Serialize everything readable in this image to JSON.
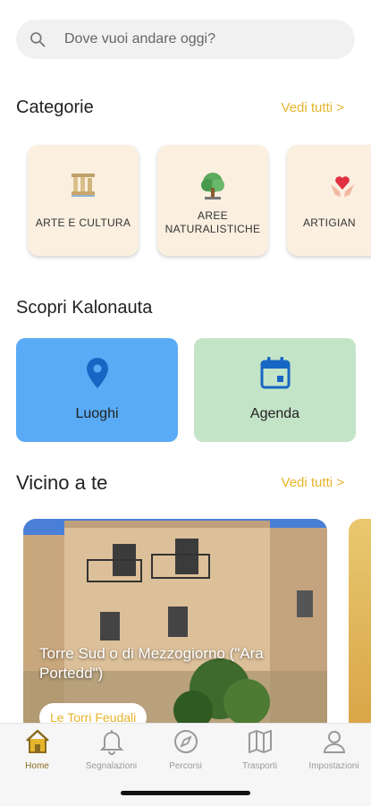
{
  "search": {
    "placeholder": "Dove vuoi andare oggi?",
    "icon": "search-icon"
  },
  "categories": {
    "title": "Categorie",
    "see_all": "Vedi tutti >",
    "items": [
      {
        "label": "ARTE E CULTURA",
        "icon": "columns-icon"
      },
      {
        "label": "AREE NATURALISTICHE",
        "icon": "tree-icon"
      },
      {
        "label": "ARTIGIAN",
        "icon": "heart-hands-icon"
      }
    ]
  },
  "discover": {
    "title": "Scopri Kalonauta",
    "tiles": [
      {
        "label": "Luoghi",
        "icon": "location-pin-icon",
        "color": "#5aabf5"
      },
      {
        "label": "Agenda",
        "icon": "calendar-icon",
        "color": "#c4e4c8"
      }
    ]
  },
  "nearby": {
    "title": "Vicino a te",
    "see_all": "Vedi tutti >",
    "cards": [
      {
        "title": "Torre Sud o di Mezzogiorno (\"Ara Portedd\")",
        "tag": "Le Torri Feudali"
      }
    ]
  },
  "tabbar": {
    "items": [
      {
        "label": "Home",
        "icon": "home-icon",
        "active": true
      },
      {
        "label": "Segnalazioni",
        "icon": "bell-icon",
        "active": false
      },
      {
        "label": "Percorsi",
        "icon": "compass-icon",
        "active": false
      },
      {
        "label": "Trasporti",
        "icon": "map-icon",
        "active": false
      },
      {
        "label": "Impostazioni",
        "icon": "person-icon",
        "active": false
      }
    ]
  },
  "colors": {
    "accent": "#e6b52c",
    "active_tab": "#8a6a1e",
    "category_bg": "#fbefe0"
  }
}
